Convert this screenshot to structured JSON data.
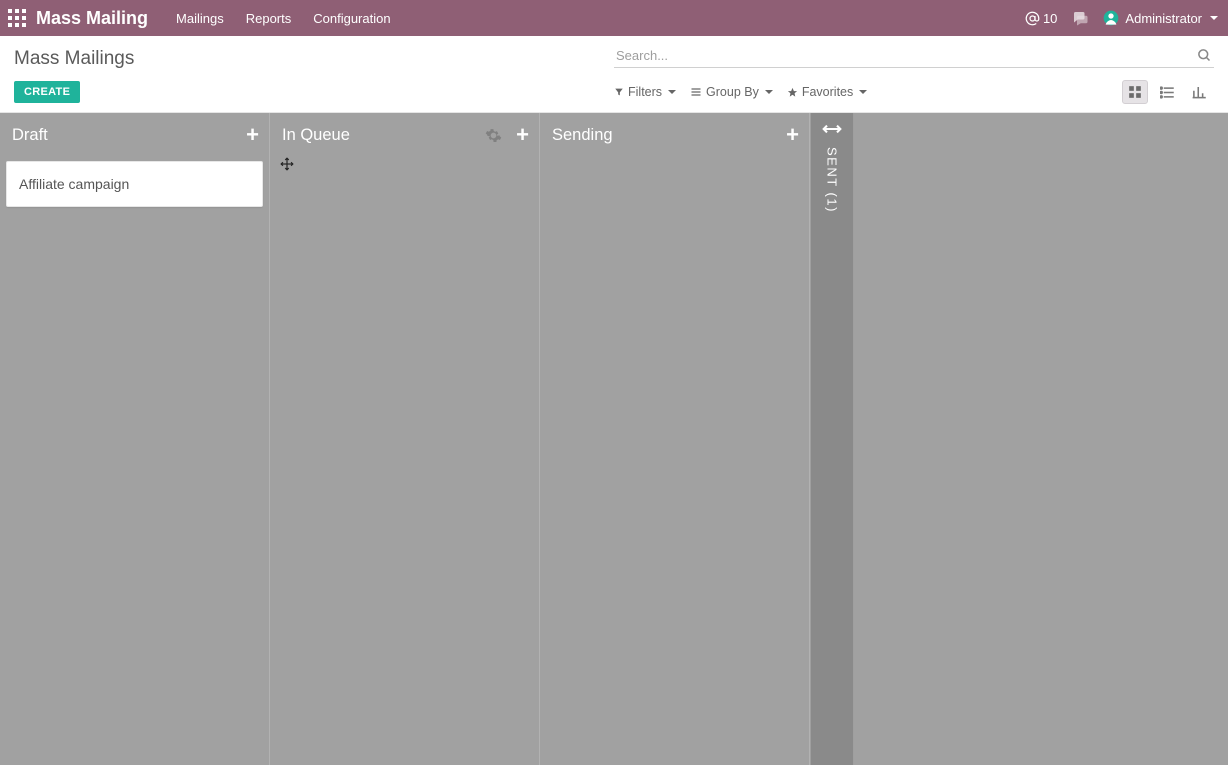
{
  "nav": {
    "brand": "Mass Mailing",
    "links": [
      "Mailings",
      "Reports",
      "Configuration"
    ],
    "at_count": "10",
    "user_name": "Administrator"
  },
  "page": {
    "title": "Mass Mailings",
    "create_label": "CREATE",
    "search_placeholder": "Search...",
    "filters_label": "Filters",
    "groupby_label": "Group By",
    "favorites_label": "Favorites"
  },
  "kanban": {
    "columns": [
      {
        "title": "Draft",
        "show_gear": false,
        "cards": [
          {
            "title": "Affiliate campaign"
          }
        ],
        "show_move_cursor": false
      },
      {
        "title": "In Queue",
        "show_gear": true,
        "cards": [],
        "show_move_cursor": true
      },
      {
        "title": "Sending",
        "show_gear": false,
        "cards": [],
        "show_move_cursor": false
      }
    ],
    "collapsed": {
      "label": "SENT (1)"
    }
  }
}
